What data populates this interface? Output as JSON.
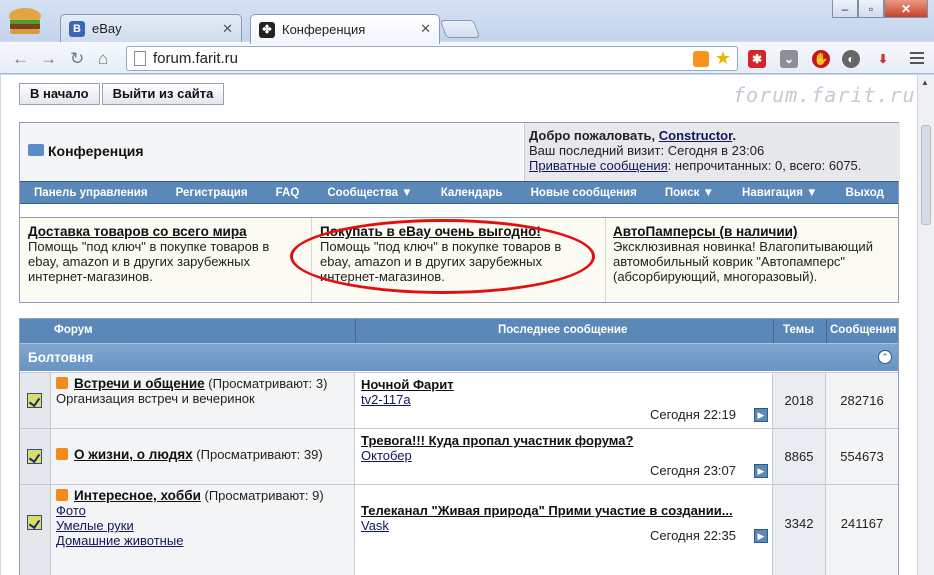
{
  "browser": {
    "tabs": [
      {
        "label": "eBay",
        "fav": "B"
      },
      {
        "label": "Конференция",
        "fav": ""
      }
    ],
    "url": "forum.farit.ru"
  },
  "page": {
    "topbar": {
      "home": "В начало",
      "logout": "Выйти из сайта"
    },
    "logo": "forum.farit.ru",
    "header": {
      "title": "Конференция",
      "welcome_prefix": "Добро пожаловать, ",
      "user": "Constructor",
      "welcome_suffix": ".",
      "last_visit": "Ваш последний визит: Сегодня в 23:06",
      "pm_link": "Приватные сообщения",
      "pm_rest": ": непрочитанных: 0, всего: 6075."
    },
    "navbar": [
      "Панель управления",
      "Регистрация",
      "FAQ",
      "Сообщества ▼",
      "Календарь",
      "Новые сообщения",
      "Поиск ▼",
      "Навигация ▼",
      "Выход"
    ],
    "ads": [
      {
        "title": "Доставка товаров со всего мира",
        "text": "Помощь \"под ключ\" в покупке товаров в ebay, amazon и в других зарубежных интернет-магазинов."
      },
      {
        "title": "Покупать в eBay очень выгодно!",
        "text": "Помощь \"под ключ\" в покупке товаров в ebay, amazon и в других зарубежных интернет-магазинов."
      },
      {
        "title": "АвтоПамперсы (в наличии)",
        "text": "Эксклюзивная новинка! Влагопитывающий автомобильный коврик \"Автопамперс\" (абсорбирующий, многоразовый)."
      }
    ],
    "table": {
      "headers": {
        "forum": "Форум",
        "last_post": "Последнее сообщение",
        "threads": "Темы",
        "posts": "Сообщения"
      },
      "category": "Болтовня",
      "rows": [
        {
          "title": "Встречи и общение",
          "viewing": "(Просматривают: 3)",
          "desc": "Организация встреч и вечеринок",
          "subforums": [],
          "lp_title": "Ночной Фарит",
          "lp_user": "tv2-117a",
          "lp_date": "Сегодня 22:19",
          "threads": "2018",
          "posts": "282716"
        },
        {
          "title": "О жизни, о людях",
          "viewing": "(Просматривают: 39)",
          "desc": "",
          "subforums": [],
          "lp_title": "Тревога!!! Куда пропал участник форума?",
          "lp_user": "Октобер",
          "lp_date": "Сегодня 23:07",
          "threads": "8865",
          "posts": "554673"
        },
        {
          "title": "Интересное, хобби",
          "viewing": "(Просматривают: 9)",
          "desc": "",
          "subforums": [
            "Фото",
            "Умелые руки",
            "Домашние животные"
          ],
          "lp_title": "Телеканал \"Живая природа\" Прими участие в создании...",
          "lp_user": "Vask",
          "lp_date": "Сегодня 22:35",
          "threads": "3342",
          "posts": "241167"
        }
      ]
    }
  },
  "colors": {
    "nav_blue": "#5a88b8",
    "highlight_oval": "#e01010"
  }
}
